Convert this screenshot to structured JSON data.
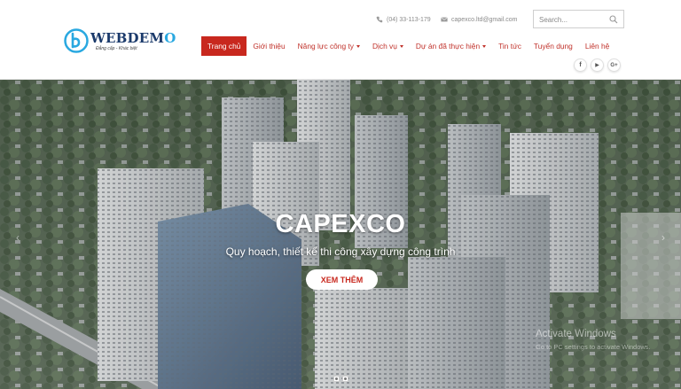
{
  "header": {
    "logo_text_main": "WEBDEM",
    "logo_text_o": "O",
    "logo_tagline": "Đẳng cấp - Khác biệt",
    "phone": "(04) 33-113-179",
    "email": "capexco.ltd@gmail.com",
    "search_placeholder": "Search..."
  },
  "nav": {
    "items": [
      {
        "label": "Trang chủ",
        "active": true
      },
      {
        "label": "Giới thiệu"
      },
      {
        "label": "Năng lực công ty",
        "dropdown": true
      },
      {
        "label": "Dịch vụ",
        "dropdown": true
      },
      {
        "label": "Dự án đã thực hiện",
        "dropdown": true
      },
      {
        "label": "Tin tức"
      },
      {
        "label": "Tuyển dụng"
      },
      {
        "label": "Liên hệ"
      }
    ]
  },
  "social": {
    "facebook": "f",
    "youtube": "▶",
    "google": "G+"
  },
  "hero": {
    "title": "CAPEXCO",
    "subtitle": "Quy hoạch, thiết kế thi công xây dựng công trình",
    "button": "XEM THÊM",
    "prev_arrow": "‹",
    "next_arrow": "›"
  },
  "watermark": {
    "line1": "Activate Windows",
    "line2": "Go to PC settings to activate Windows."
  },
  "colors": {
    "accent": "#c8281e",
    "logo_blue": "#1b3a6b",
    "logo_light_blue": "#29a8e0"
  }
}
